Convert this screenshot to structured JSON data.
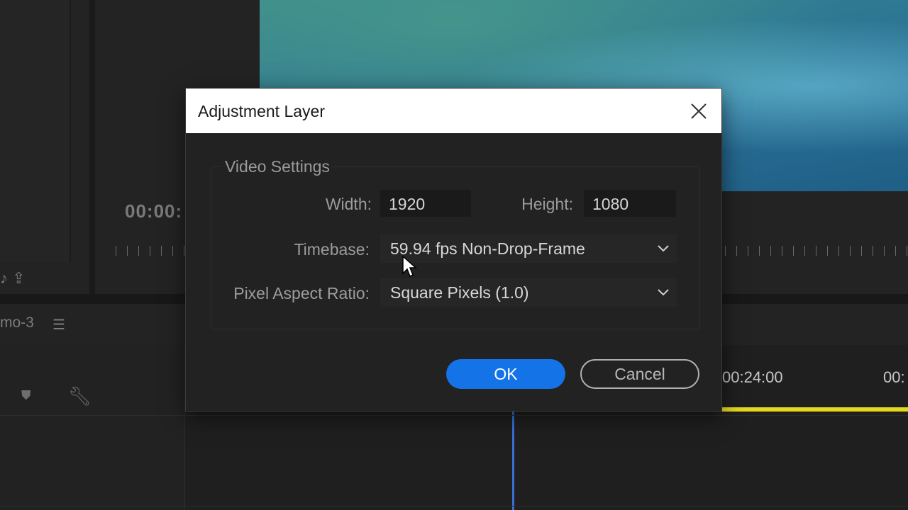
{
  "background": {
    "timecode": "00:00:",
    "sequence_tab": "mo-3",
    "timeline_times": [
      "00:24:00",
      "00:"
    ]
  },
  "dialog": {
    "title": "Adjustment Layer",
    "group_title": "Video Settings",
    "width_label": "Width:",
    "width_value": "1920",
    "height_label": "Height:",
    "height_value": "1080",
    "timebase_label": "Timebase:",
    "timebase_value": "59.94 fps Non-Drop-Frame",
    "par_label": "Pixel Aspect Ratio:",
    "par_value": "Square Pixels (1.0)",
    "ok_label": "OK",
    "cancel_label": "Cancel"
  },
  "colors": {
    "accent": "#1473e6",
    "playhead": "#3a6fd8",
    "work_area": "#e5d81e"
  }
}
